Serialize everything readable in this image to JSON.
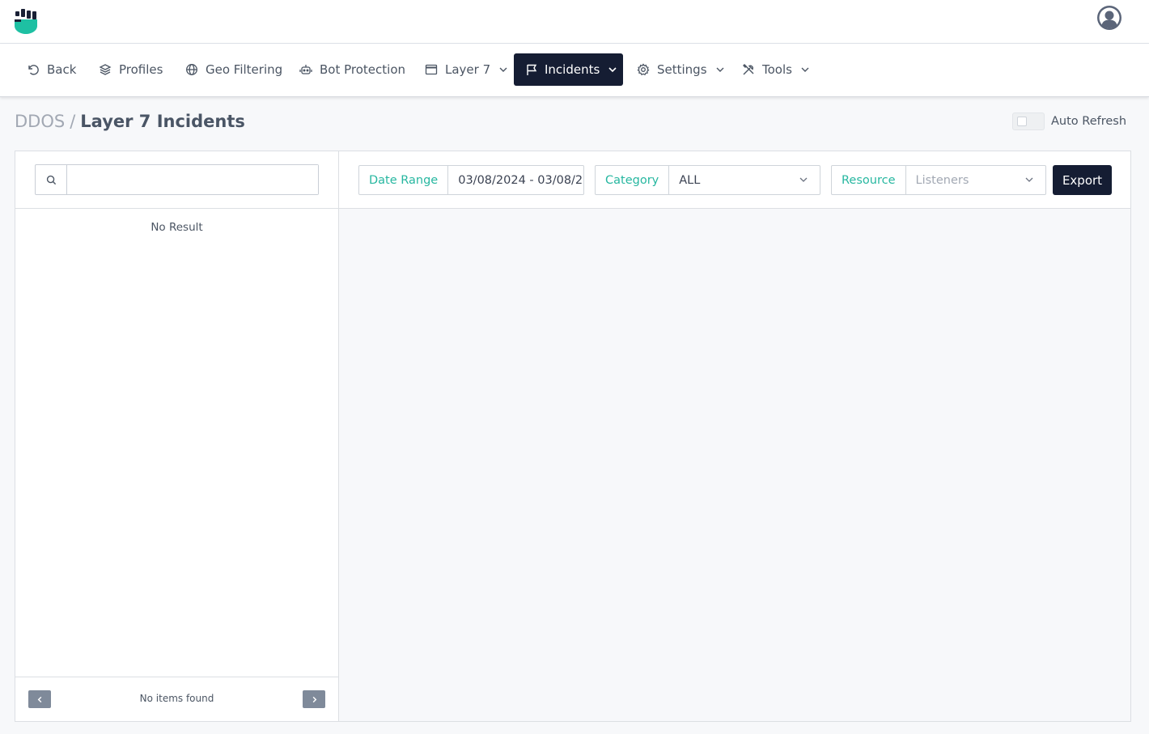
{
  "colors": {
    "accent": "#27b7a0",
    "nav_active_bg": "#151d33",
    "brand_logo": "#1ec0a3"
  },
  "header": {
    "logo_icon": "fist-shield-logo",
    "avatar_icon": "user-avatar-icon"
  },
  "nav": {
    "items": [
      {
        "label": "Back",
        "icon": "undo-icon",
        "dropdown": false
      },
      {
        "label": "Profiles",
        "icon": "layers-icon",
        "dropdown": false
      },
      {
        "label": "Geo Filtering",
        "icon": "globe-icon",
        "dropdown": false
      },
      {
        "label": "Bot Protection",
        "icon": "robot-icon",
        "dropdown": false
      },
      {
        "label": "Layer 7",
        "icon": "window-icon",
        "dropdown": true
      },
      {
        "label": "Incidents",
        "icon": "flag-icon",
        "dropdown": true,
        "active": true
      },
      {
        "label": "Settings",
        "icon": "gear-icon",
        "dropdown": true
      },
      {
        "label": "Tools",
        "icon": "tools-icon",
        "dropdown": true
      }
    ]
  },
  "breadcrumb": {
    "root": "DDOS",
    "separator": "/",
    "current": "Layer 7 Incidents"
  },
  "auto_refresh": {
    "label": "Auto Refresh",
    "enabled": false
  },
  "search": {
    "value": "",
    "placeholder": ""
  },
  "list": {
    "empty_text": "No Result"
  },
  "pagination": {
    "text": "No items found"
  },
  "filters": {
    "date_range": {
      "label": "Date Range",
      "value": "03/08/2024 - 03/08/2"
    },
    "category": {
      "label": "Category",
      "value": "ALL"
    },
    "resource": {
      "label": "Resource",
      "placeholder": "Listeners"
    }
  },
  "actions": {
    "export_label": "Export"
  }
}
